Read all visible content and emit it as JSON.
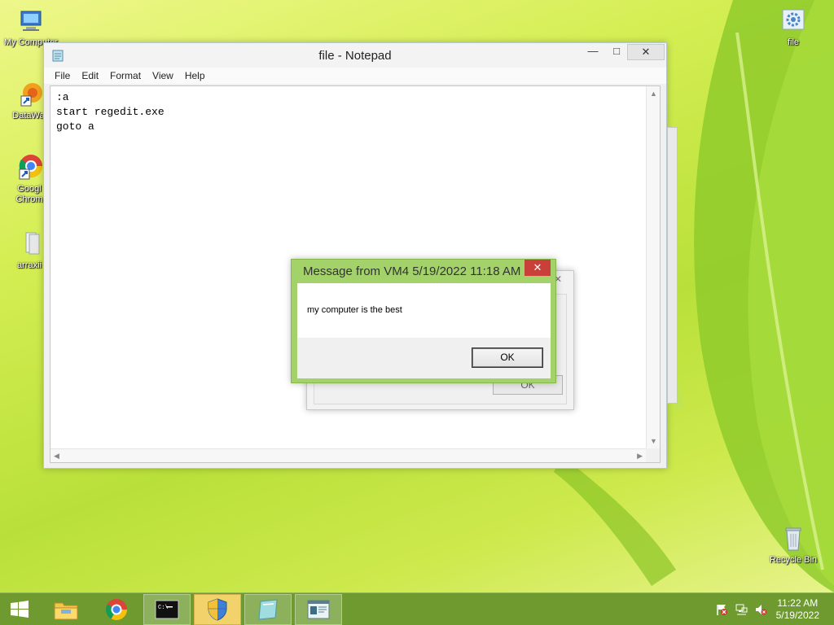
{
  "desktop": {
    "icons_left": [
      {
        "label": "My Computer"
      },
      {
        "label": "DataWag"
      },
      {
        "label": "Googl Chrom"
      },
      {
        "label": "arraxii"
      }
    ],
    "icons_right": [
      {
        "label": "file"
      },
      {
        "label": "Recycle Bin"
      }
    ]
  },
  "notepad": {
    "title": "file - Notepad",
    "menu": [
      "File",
      "Edit",
      "Format",
      "View",
      "Help"
    ],
    "content": ":a\nstart regedit.exe\ngoto a"
  },
  "message_box": {
    "title": "Message from VM4 5/19/2022 11:18 AM",
    "text": "my computer is the best",
    "ok_label": "OK"
  },
  "message_box_back": {
    "ok_label": "OK"
  },
  "taskbar": {
    "clock_time": "11:22 AM",
    "clock_date": "5/19/2022"
  },
  "colors": {
    "taskbar": "#6e9a2f",
    "dialog_frame": "#a3d26a",
    "close_button": "#c9403b"
  }
}
